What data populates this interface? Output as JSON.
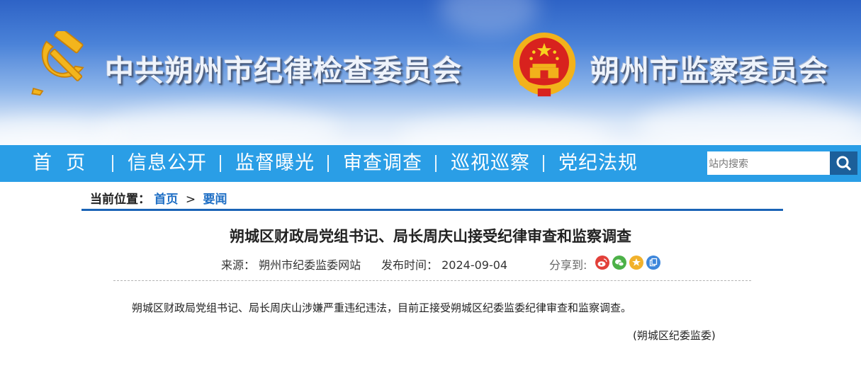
{
  "header": {
    "commission_title": "中共朔州市纪律检查委员会",
    "supervision_title": "朔州市监察委员会",
    "party_emblem": "hammer-sickle-icon",
    "national_emblem": "national-emblem-icon",
    "colors": {
      "banner_top": "#2e63c6",
      "emblem_red": "#d8221e",
      "emblem_gold": "#f2b21b"
    }
  },
  "nav": {
    "items": [
      {
        "label": "首  页"
      },
      {
        "label": "信息公开"
      },
      {
        "label": "监督曝光"
      },
      {
        "label": "审查调查"
      },
      {
        "label": "巡视巡察"
      },
      {
        "label": "党纪法规"
      }
    ],
    "search_placeholder": "站内搜索",
    "search_icon": "search-icon",
    "bar_color": "#2a9ee6"
  },
  "breadcrumb": {
    "label": "当前位置：",
    "home": "首页",
    "separator": ">",
    "current": "要闻"
  },
  "article": {
    "title": "朔城区财政局党组书记、局长周庆山接受纪律审查和监察调查",
    "source_label": "来源：",
    "source": "朔州市纪委监委网站",
    "date_label": "发布时间：",
    "date": "2024-09-04",
    "share_label": "分享到:",
    "share_icons": [
      "weibo-icon",
      "wechat-icon",
      "qzone-icon",
      "copy-link-icon"
    ],
    "body": "朔城区财政局党组书记、局长周庆山涉嫌严重违纪违法，目前正接受朔城区纪委监委纪律审查和监察调查。",
    "signature": "(朔城区纪委监委)"
  }
}
